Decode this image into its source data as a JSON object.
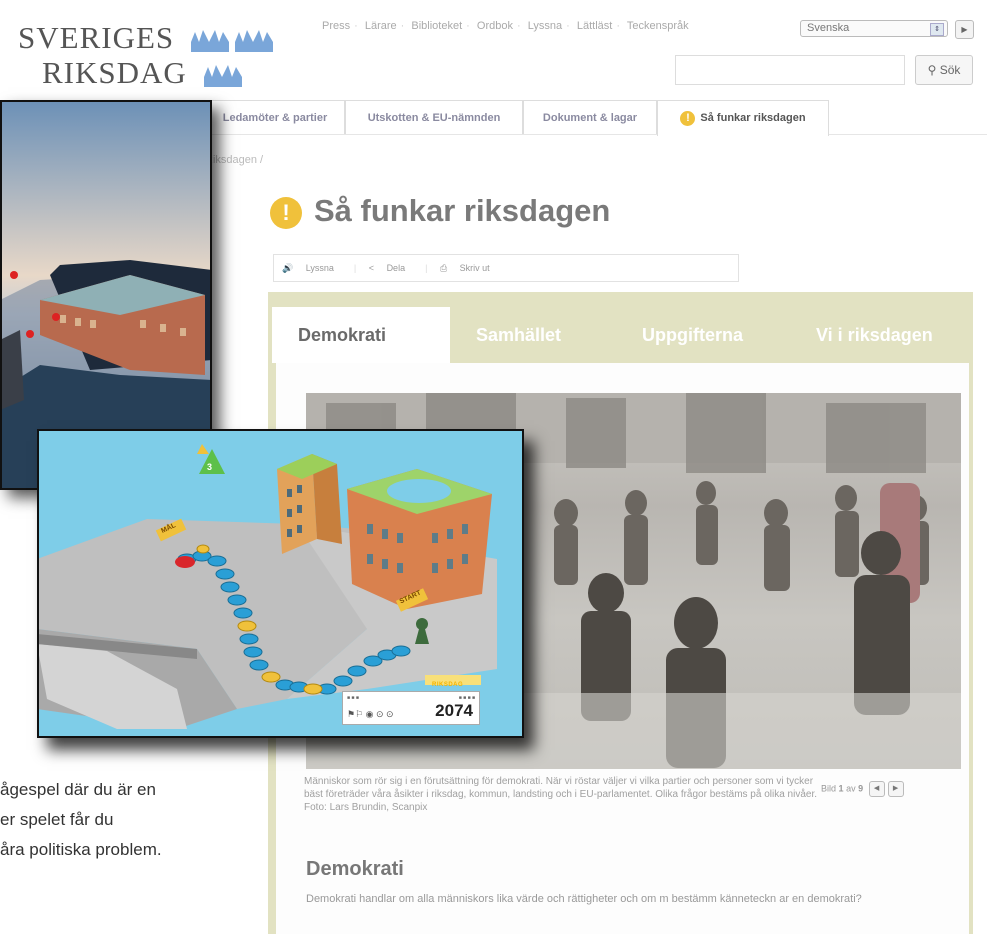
{
  "site": {
    "logo_line1": "SVERIGES",
    "logo_line2": "RIKSDAG",
    "top_links": [
      "Press",
      "Lärare",
      "Biblioteket",
      "Ordbok",
      "Lyssna",
      "Lättläst",
      "Teckenspråk"
    ],
    "language_select": "Svenska",
    "search_placeholder": "",
    "search_button": "Sök",
    "nav_tabs": [
      "Ledamöter & partier",
      "Utskotten & EU-nämnden",
      "Dokument & lagar",
      "Så funkar riksdagen"
    ],
    "nav_active_index": 3,
    "breadcrumb": "Riksdagen /",
    "page_title": "Så funkar riksdagen",
    "toolbar": {
      "listen": "Lyssna",
      "share": "Dela",
      "print": "Skriv ut"
    },
    "content_tabs": [
      "Demokrati",
      "Samhället",
      "Uppgifterna",
      "Vi i riksdagen"
    ],
    "content_tab_active": 0,
    "photo_caption": "Människor som rör sig i en förutsättning för demokrati. När vi röstar väljer vi vilka partier och personer som vi tycker bäst företräder våra åsikter i riksdag, kommun, landsting och i EU-parlamentet. Olika frågor bestäms på olika nivåer.",
    "photo_credit": "Foto: Lars Brundin, Scanpix",
    "pager": {
      "prefix": "Bild",
      "current": "1",
      "of": "av",
      "total": "9"
    },
    "section_heading": "Demokrati",
    "section_text": "Demokrati handlar om alla människors lika värde och rättigheter och om m bestämm känneteckn ar en demokrati?"
  },
  "overlay": {
    "blurb_lines": [
      "ågespel där du är en",
      "er spelet får du",
      "åra politiska problem."
    ]
  },
  "game": {
    "score": "2074",
    "brand": "RIKSDAG",
    "dice_value": "3",
    "goal_label": "MÅL",
    "start_label": "START"
  },
  "colors": {
    "panel_bg": "#e2e2c2",
    "tab_inactive": "#cfcfa6",
    "accent_yellow": "#f0c13b",
    "water": "#7ecde8"
  }
}
